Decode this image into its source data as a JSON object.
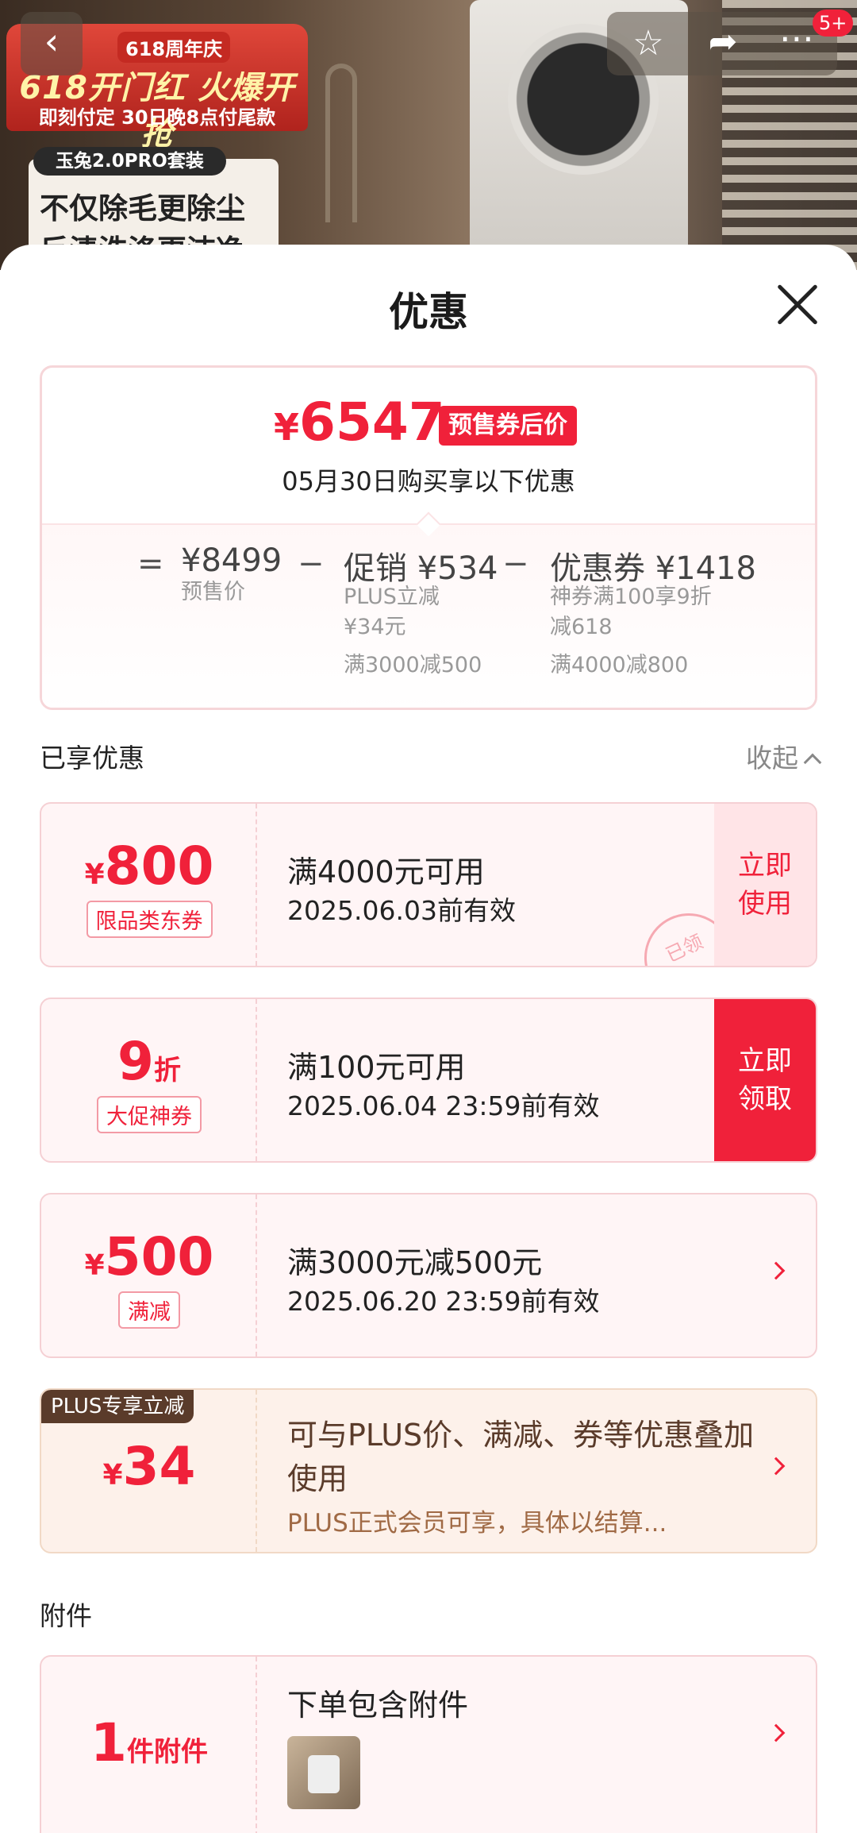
{
  "header": {
    "promo_anniversary": "618周年庆",
    "promo_title": "618开门红 火爆开抢",
    "promo_sub": "即刻付定 30日晚8点付尾款",
    "package_tag": "玉兔2.0PRO套装",
    "slogan_line1": "不仅除毛更除尘",
    "slogan_line2": "反渍洗涤更洁净",
    "badge_count": "5+"
  },
  "icons": {
    "back": "back-arrow-icon",
    "star": "star-icon",
    "share": "share-icon",
    "more": "more-icon",
    "close": "close-icon"
  },
  "sheet": {
    "title": "优惠"
  },
  "summary": {
    "currency": "¥",
    "final_price": "6547",
    "final_tag": "预售券后价",
    "date_line": "05月30日购买享以下优惠",
    "equals": "=",
    "minus": "−",
    "presale_price": "¥8499",
    "presale_label": "预售价",
    "promo_label": "促销 ¥534",
    "promo_line1": "PLUS立减",
    "promo_line2": "¥34元",
    "promo_line3": "满3000减500",
    "coupon_label": "优惠券 ¥1418",
    "coupon_line1": "神券满100享9折",
    "coupon_line2": "减618",
    "coupon_line3": "满4000减800"
  },
  "enjoyed": {
    "title": "已享优惠",
    "collapse": "收起"
  },
  "coupons": [
    {
      "currency": "¥",
      "amount": "800",
      "label": "限品类东券",
      "condition": "满4000元可用",
      "validity": "2025.06.03前有效",
      "action_line1": "立即",
      "action_line2": "使用",
      "stamp": "已领"
    },
    {
      "amount": "9",
      "unit": "折",
      "label": "大促神券",
      "condition": "满100元可用",
      "validity": "2025.06.04 23:59前有效",
      "action_line1": "立即",
      "action_line2": "领取"
    },
    {
      "currency": "¥",
      "amount": "500",
      "label": "满减",
      "condition": "满3000元减500元",
      "validity": "2025.06.20 23:59前有效"
    }
  ],
  "plus": {
    "tag": "PLUS专享立减",
    "currency": "¥",
    "amount": "34",
    "desc": "可与PLUS价、满减、券等优惠叠加使用",
    "note": "PLUS正式会员可享，具体以结算..."
  },
  "accessory": {
    "section_title": "附件",
    "amount": "1",
    "unit": "件附件",
    "title": "下单包含附件"
  },
  "colors": {
    "accent": "#f0213a",
    "plus_brown": "#5a3b2a"
  }
}
